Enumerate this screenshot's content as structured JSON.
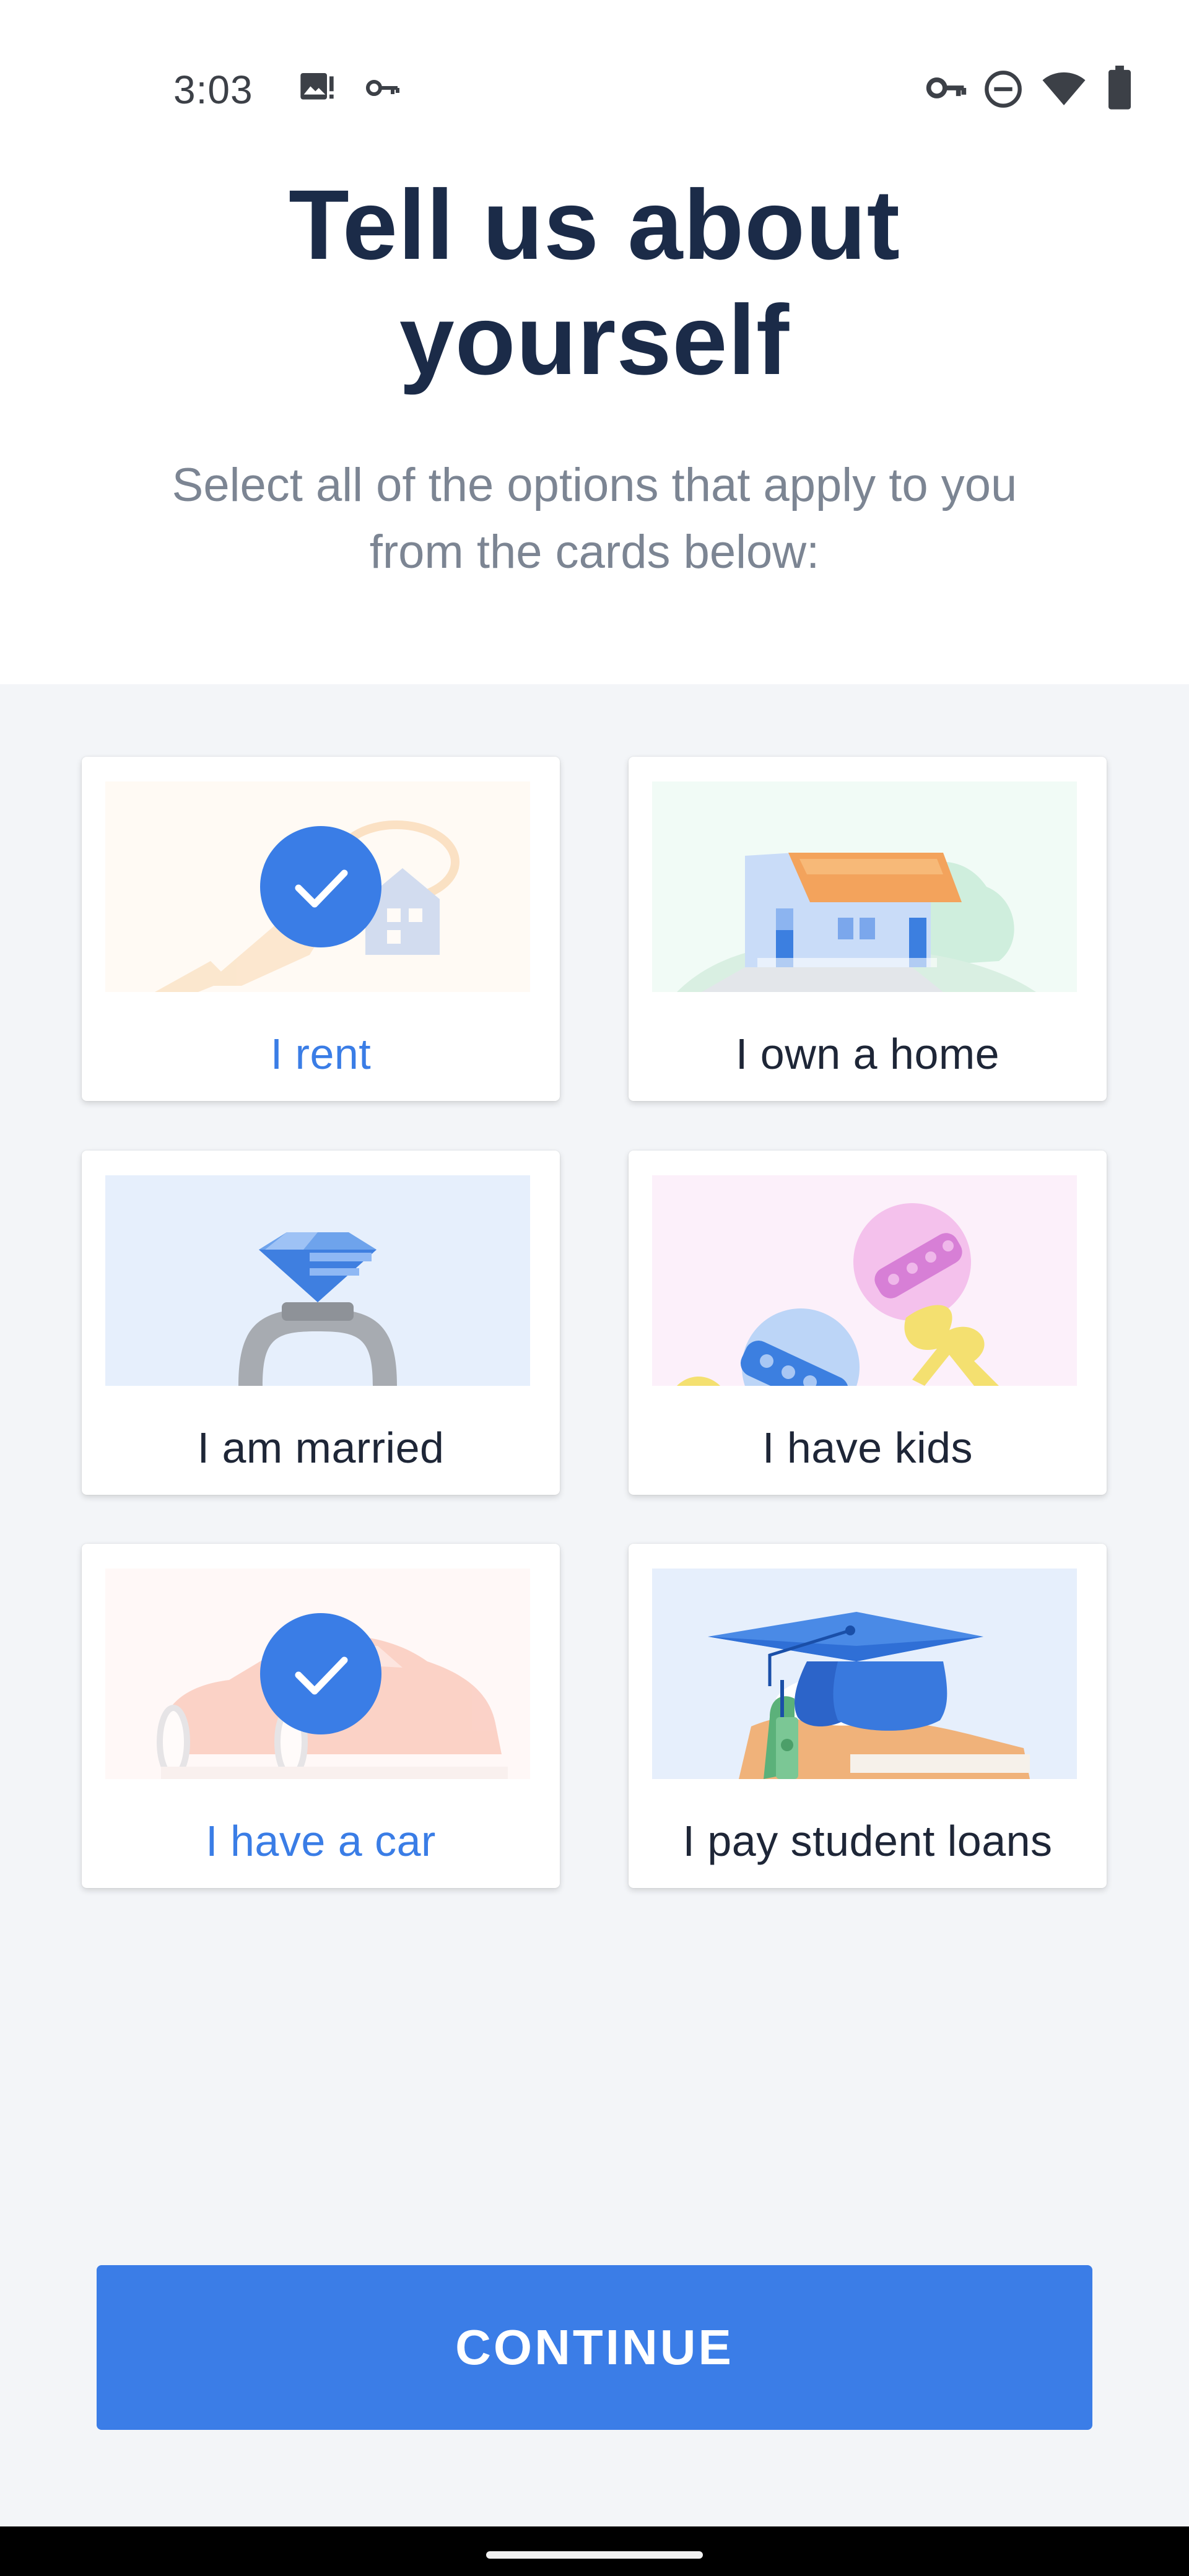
{
  "status_bar": {
    "time": "3:03",
    "left_icons": [
      "image-alert-icon",
      "key-icon"
    ],
    "right_icons": [
      "vpn-key-icon",
      "do-not-disturb-icon",
      "wifi-icon",
      "battery-icon"
    ]
  },
  "header": {
    "title_line1": "Tell us about",
    "title_line2": "yourself",
    "subtitle_line1": "Select all of the options that apply to you",
    "subtitle_line2": "from the cards below:"
  },
  "cards": [
    {
      "label": "I rent",
      "selected": true,
      "icon": "keys-illustration"
    },
    {
      "label": "I own a home",
      "selected": false,
      "icon": "house-illustration"
    },
    {
      "label": "I am married",
      "selected": false,
      "icon": "ring-illustration"
    },
    {
      "label": "I have kids",
      "selected": false,
      "icon": "rattle-illustration"
    },
    {
      "label": "I have a car",
      "selected": true,
      "icon": "car-illustration"
    },
    {
      "label": "I pay student loans",
      "selected": false,
      "icon": "graduation-cap-illustration"
    }
  ],
  "continue_button": {
    "label": "CONTINUE"
  },
  "colors": {
    "accent": "#3b7de7",
    "title": "#1b2b48",
    "subtitle": "#7c8593",
    "background_grey": "#f3f5f8"
  }
}
